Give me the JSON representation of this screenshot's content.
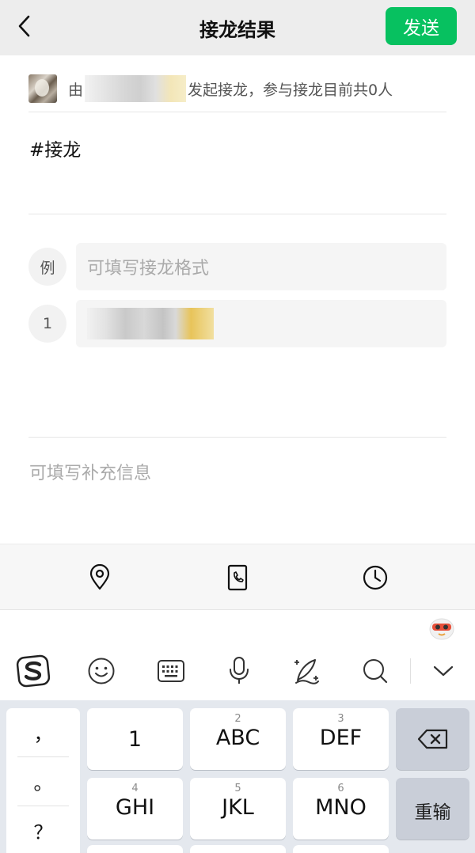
{
  "header": {
    "title": "接龙结果",
    "send_label": "发送"
  },
  "initiator": {
    "prefix": "由",
    "suffix": "发起接龙，参与接龙目前共0人"
  },
  "topic": "#接龙",
  "entries": [
    {
      "badge": "例",
      "placeholder": "可填写接龙格式"
    },
    {
      "badge": "1",
      "value": ""
    }
  ],
  "extra_info_placeholder": "可填写补充信息",
  "toolbar_icons": [
    "location-icon",
    "phone-icon",
    "clock-icon"
  ],
  "ime_toolbar_icons": [
    "sogou-logo-icon",
    "emoji-icon",
    "keyboard-icon",
    "microphone-icon",
    "handwriting-icon",
    "search-icon",
    "collapse-chevron-icon"
  ],
  "keyboard": {
    "punctuation": [
      "，",
      "。",
      "？"
    ],
    "row1": [
      {
        "num": "",
        "main": "1"
      },
      {
        "num": "2",
        "main": "ABC"
      },
      {
        "num": "3",
        "main": "DEF"
      }
    ],
    "row2": [
      {
        "num": "4",
        "main": "GHI"
      },
      {
        "num": "5",
        "main": "JKL"
      },
      {
        "num": "6",
        "main": "MNO"
      }
    ],
    "delete_label": "delete-icon",
    "retype_label": "重输"
  },
  "colors": {
    "accent": "#07c160",
    "header_bg": "#ededed",
    "keyboard_bg": "#e4e8ee"
  }
}
